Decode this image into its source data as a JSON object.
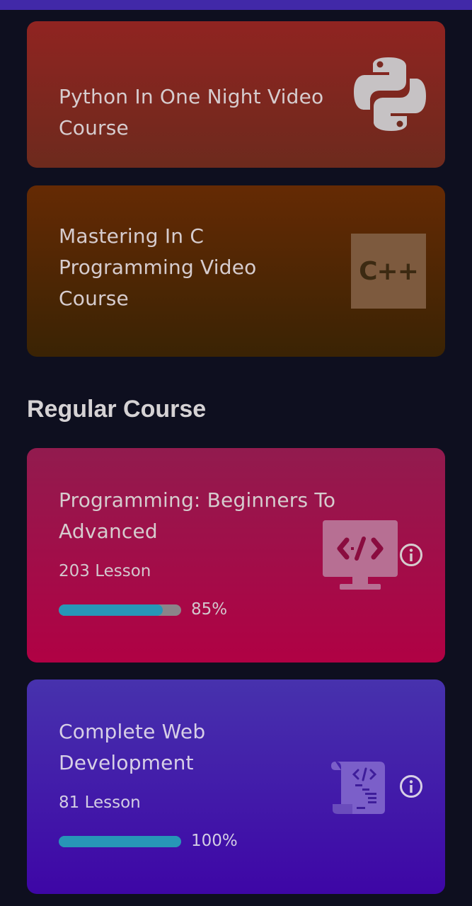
{
  "featured_courses": [
    {
      "title": "Python In One Night Video Course",
      "icon": "python-logo-icon",
      "color": "#902421"
    },
    {
      "title": "Mastering In C Programming Video Course",
      "icon": "cpp-logo-icon",
      "icon_text": "C++",
      "color": "#652a04"
    }
  ],
  "section": {
    "title": "Regular Course"
  },
  "regular_courses": [
    {
      "title": "Programming: Beginners To Advanced",
      "lessons": "203 Lesson",
      "progress": 85,
      "progress_label": "85%",
      "icon": "code-monitor-icon",
      "color": "#b00144"
    },
    {
      "title": "Complete Web Development",
      "lessons": "81 Lesson",
      "progress": 100,
      "progress_label": "100%",
      "icon": "code-scroll-icon",
      "color": "#3e06a6"
    }
  ]
}
